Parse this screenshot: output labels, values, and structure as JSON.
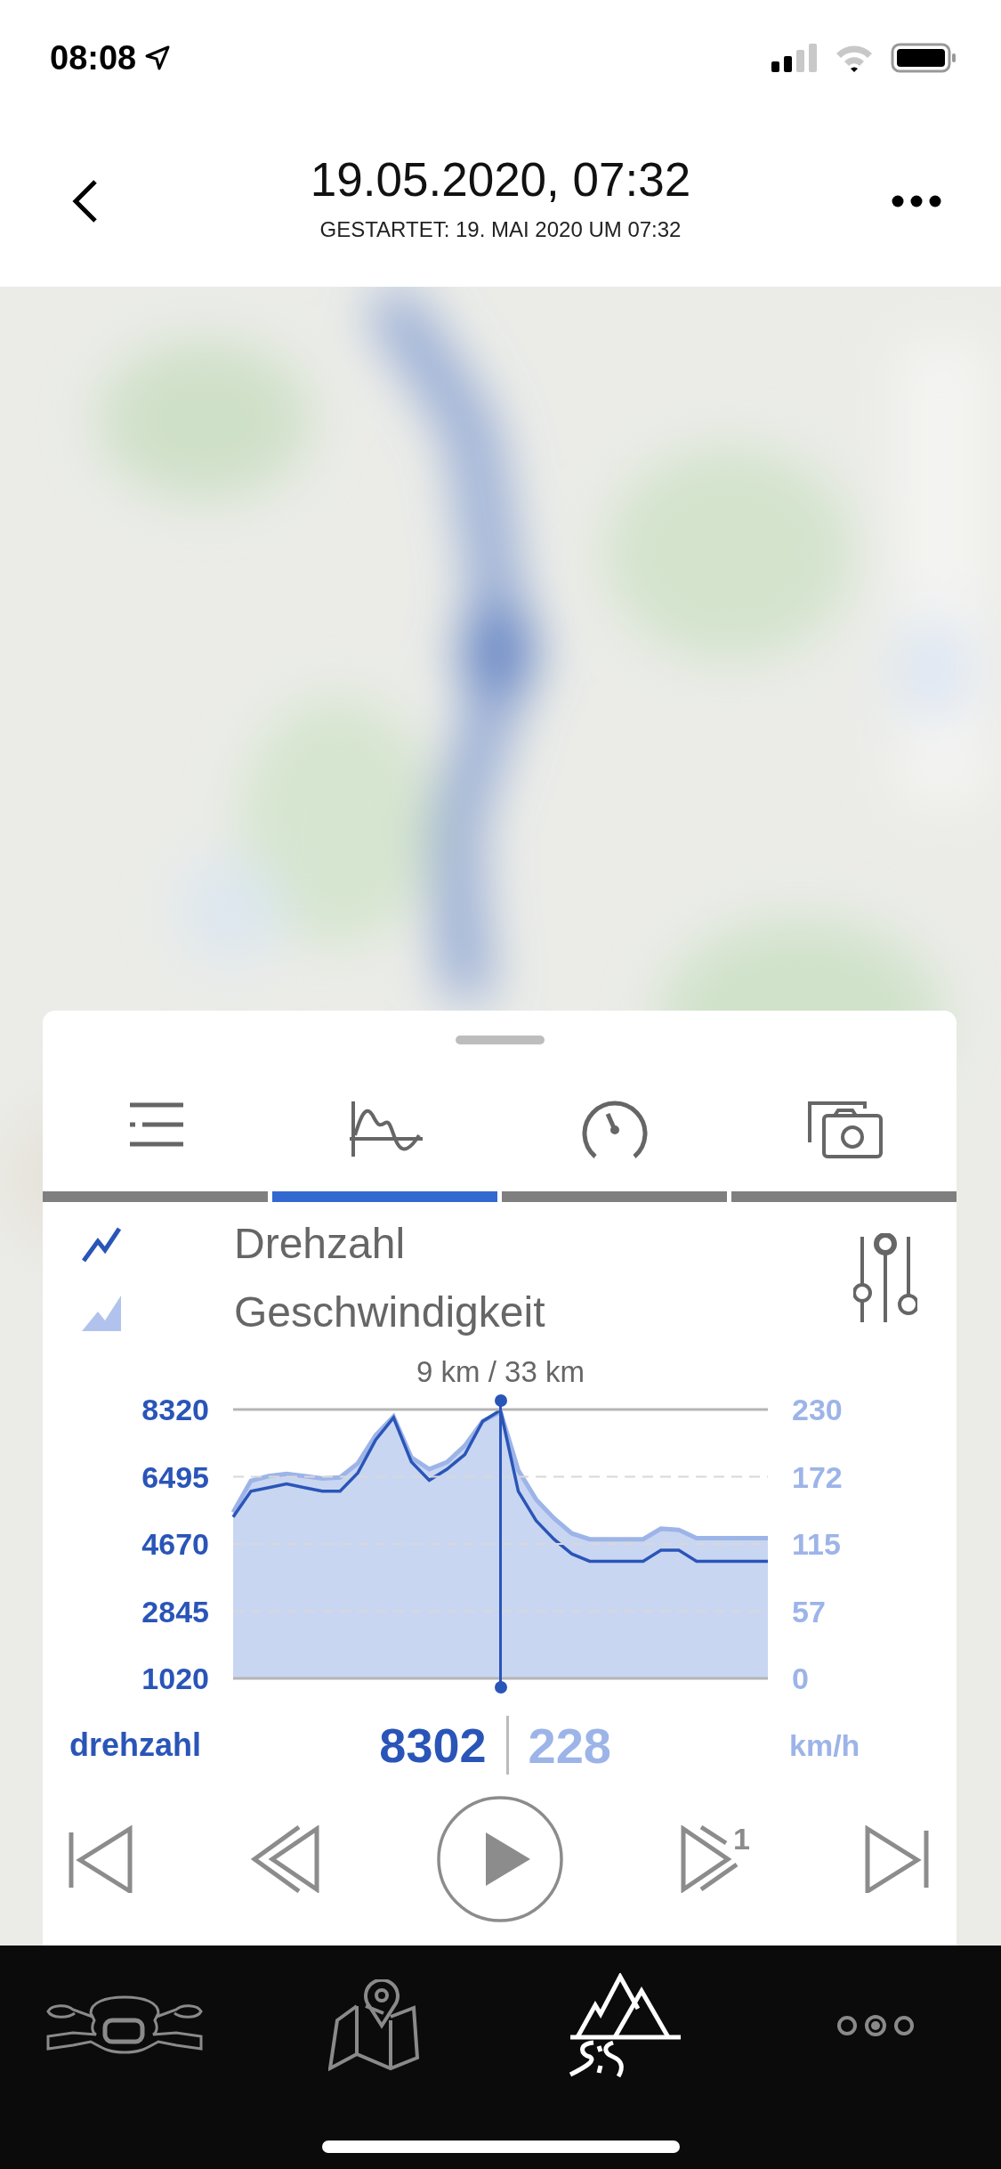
{
  "status_bar": {
    "time": "08:08"
  },
  "header": {
    "title": "19.05.2020, 07:32",
    "subtitle": "GESTARTET: 19. MAI 2020 UM 07:32"
  },
  "panel": {
    "tabs": [
      {
        "kind": "list",
        "selected": false
      },
      {
        "kind": "chart",
        "selected": true
      },
      {
        "kind": "gauge",
        "selected": false
      },
      {
        "kind": "photos",
        "selected": false
      }
    ],
    "charts": [
      {
        "chart_data": {
          "type": "line",
          "categories": [
            null,
            null,
            null,
            null,
            null,
            null,
            null,
            null,
            null,
            null,
            null,
            null,
            null,
            null,
            null,
            null,
            null,
            null,
            null,
            null,
            null,
            null,
            null,
            null,
            null,
            null,
            null,
            null,
            null,
            null,
            null
          ],
          "ylim": [
            1020,
            8320
          ],
          "yticks": [
            1020,
            2845,
            4670,
            6495,
            8320
          ],
          "grid": true,
          "series": [
            {
              "name": "Drehzahl",
              "color": "#2a55b8",
              "values": [
                5400,
                6100,
                6200,
                6300,
                6200,
                6100,
                6100,
                6600,
                7500,
                8100,
                6900,
                6400,
                6700,
                7100,
                8000,
                8300,
                6100,
                5300,
                4800,
                4400,
                4200,
                4200,
                4200,
                4200,
                4500,
                4500,
                4200,
                4200,
                4200,
                4200,
                4200
              ]
            }
          ]
        }
      },
      {
        "chart_data": {
          "type": "area",
          "categories": [
            null,
            null,
            null,
            null,
            null,
            null,
            null,
            null,
            null,
            null,
            null,
            null,
            null,
            null,
            null,
            null,
            null,
            null,
            null,
            null,
            null,
            null,
            null,
            null,
            null,
            null,
            null,
            null,
            null,
            null,
            null
          ],
          "ylim": [
            0,
            230
          ],
          "yticks": [
            0,
            57,
            115,
            172,
            230
          ],
          "series": [
            {
              "name": "Geschwindigkeit",
              "color": "#9db4e8",
              "values": [
                142,
                169,
                173,
                175,
                173,
                171,
                172,
                184,
                208,
                224,
                189,
                179,
                185,
                199,
                220,
                228,
                178,
                153,
                137,
                124,
                119,
                119,
                119,
                119,
                128,
                127,
                120,
                120,
                120,
                120,
                120
              ]
            }
          ]
        }
      }
    ],
    "scrubber": {
      "label": "9 km / 33 km"
    },
    "readout": {
      "label": "drehzahl",
      "primary": "8302",
      "secondary": "228",
      "unit": "km/h"
    },
    "controls": [
      {
        "kind": "first"
      },
      {
        "kind": "rewind"
      },
      {
        "kind": "play"
      },
      {
        "kind": "step",
        "badge": "1"
      },
      {
        "kind": "last"
      }
    ]
  },
  "nav": [
    {
      "kind": "motorcycle",
      "selected": false
    },
    {
      "kind": "map",
      "selected": false
    },
    {
      "kind": "trips",
      "selected": true
    },
    {
      "kind": "more",
      "selected": false
    }
  ]
}
